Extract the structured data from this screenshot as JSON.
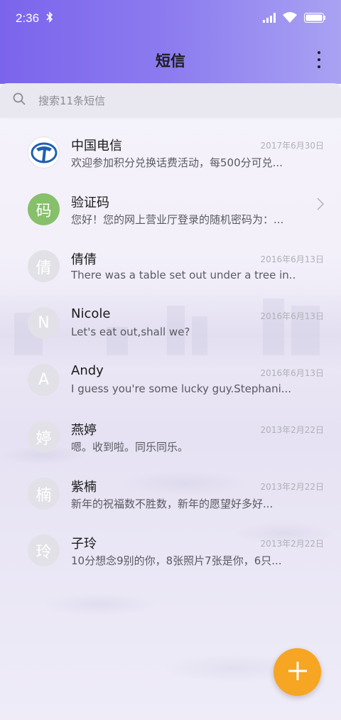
{
  "status_bar": {
    "time": "2:36"
  },
  "header": {
    "title": "短信"
  },
  "search": {
    "placeholder": "搜索11条短信"
  },
  "conversations": [
    {
      "avatar": "",
      "name": "中国电信",
      "date": "2017年6月30日",
      "preview": "欢迎参加积分兑换话费活动，每500分可兑..."
    },
    {
      "avatar": "码",
      "name": "验证码",
      "date": "",
      "preview": "您好！您的网上营业厅登录的随机密码为：..."
    },
    {
      "avatar": "倩",
      "name": "倩倩",
      "date": "2016年6月13日",
      "preview": "There was a table set out under a tree in..."
    },
    {
      "avatar": "N",
      "name": "Nicole",
      "date": "2016年6月13日",
      "preview": "Let's eat out,shall we?"
    },
    {
      "avatar": "A",
      "name": "Andy",
      "date": "2016年6月13日",
      "preview": "I guess you're some lucky guy.Stephani..."
    },
    {
      "avatar": "婷",
      "name": "燕婷",
      "date": "2013年2月22日",
      "preview": "嗯。收到啦。同乐同乐。"
    },
    {
      "avatar": "楠",
      "name": "紫楠",
      "date": "2013年2月22日",
      "preview": "新年的祝福数不胜数，新年的愿望好多好..."
    },
    {
      "avatar": "玲",
      "name": "子玲",
      "date": "2013年2月22日",
      "preview": "10分想念9别的你，8张照片7张是你，6只..."
    }
  ],
  "icons": [
    "bluetooth-icon",
    "signal-icon",
    "wifi-icon",
    "battery-icon",
    "more-icon",
    "search-icon",
    "chevron-right-icon",
    "plus-icon"
  ],
  "colors": {
    "header_start": "#7b64ec",
    "header_end": "#a9a2f3",
    "fab": "#f6a623",
    "verify_avatar": "#86c06a"
  }
}
